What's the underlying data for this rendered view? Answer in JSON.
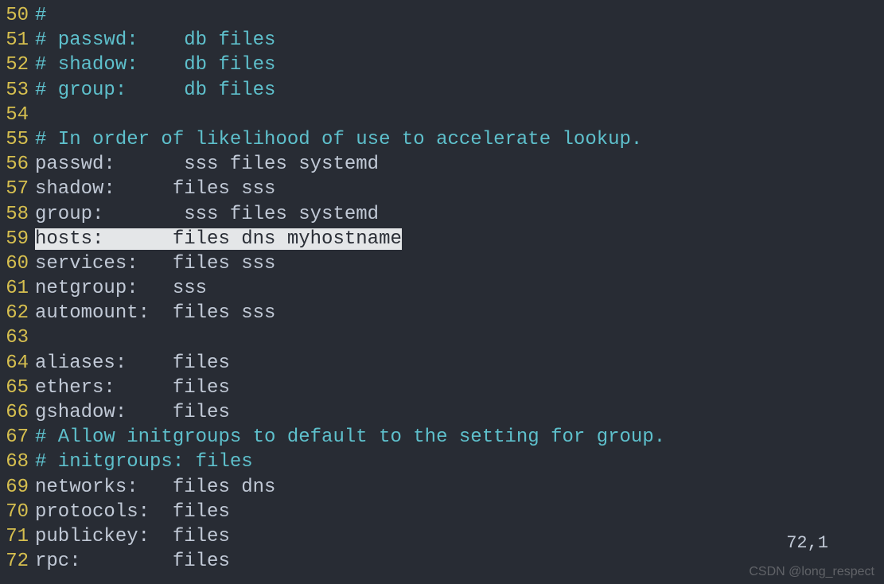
{
  "status_position": "72,1",
  "watermark": "CSDN @long_respect",
  "lines": [
    {
      "num": 50,
      "type": "comment",
      "text": "#"
    },
    {
      "num": 51,
      "type": "comment",
      "text": "# passwd:    db files"
    },
    {
      "num": 52,
      "type": "comment",
      "text": "# shadow:    db files"
    },
    {
      "num": 53,
      "type": "comment",
      "text": "# group:     db files"
    },
    {
      "num": 54,
      "type": "blank",
      "text": ""
    },
    {
      "num": 55,
      "type": "comment",
      "text": "# In order of likelihood of use to accelerate lookup."
    },
    {
      "num": 56,
      "type": "plain",
      "text": "passwd:      sss files systemd"
    },
    {
      "num": 57,
      "type": "plain",
      "text": "shadow:     files sss"
    },
    {
      "num": 58,
      "type": "plain",
      "text": "group:       sss files systemd"
    },
    {
      "num": 59,
      "type": "selected",
      "text": "hosts:      files dns myhostname"
    },
    {
      "num": 60,
      "type": "plain",
      "text": "services:   files sss"
    },
    {
      "num": 61,
      "type": "plain",
      "text": "netgroup:   sss"
    },
    {
      "num": 62,
      "type": "plain",
      "text": "automount:  files sss"
    },
    {
      "num": 63,
      "type": "blank",
      "text": ""
    },
    {
      "num": 64,
      "type": "plain",
      "text": "aliases:    files"
    },
    {
      "num": 65,
      "type": "plain",
      "text": "ethers:     files"
    },
    {
      "num": 66,
      "type": "plain",
      "text": "gshadow:    files"
    },
    {
      "num": 67,
      "type": "comment",
      "text": "# Allow initgroups to default to the setting for group."
    },
    {
      "num": 68,
      "type": "comment",
      "text": "# initgroups: files"
    },
    {
      "num": 69,
      "type": "plain",
      "text": "networks:   files dns"
    },
    {
      "num": 70,
      "type": "plain",
      "text": "protocols:  files"
    },
    {
      "num": 71,
      "type": "plain",
      "text": "publickey:  files"
    },
    {
      "num": 72,
      "type": "plain",
      "text": "rpc:        files"
    }
  ]
}
